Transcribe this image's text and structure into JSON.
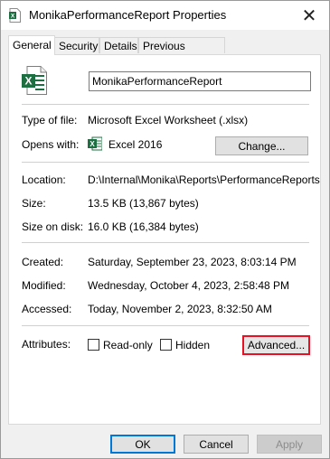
{
  "window": {
    "title": "MonikaPerformanceReport Properties",
    "close_glyph": "✕"
  },
  "tabs": [
    {
      "label": "General",
      "active": true
    },
    {
      "label": "Security"
    },
    {
      "label": "Details"
    },
    {
      "label": "Previous Versions"
    }
  ],
  "general": {
    "file_name": "MonikaPerformanceReport",
    "type_label": "Type of file:",
    "type_value": "Microsoft Excel Worksheet (.xlsx)",
    "opens_label": "Opens with:",
    "opens_value": "Excel 2016",
    "change_button": "Change...",
    "location_label": "Location:",
    "location_value": "D:\\Internal\\Monika\\Reports\\PerformanceReports",
    "size_label": "Size:",
    "size_value": "13.5 KB (13,867 bytes)",
    "size_disk_label": "Size on disk:",
    "size_disk_value": "16.0 KB (16,384 bytes)",
    "created_label": "Created:",
    "created_value": "Saturday, September 23, 2023, 8:03:14 PM",
    "modified_label": "Modified:",
    "modified_value": "Wednesday, October 4, 2023, 2:58:48 PM",
    "accessed_label": "Accessed:",
    "accessed_value": "Today, November 2, 2023, 8:32:50 AM",
    "attributes_label": "Attributes:",
    "readonly_label": "Read-only",
    "hidden_label": "Hidden",
    "advanced_button": "Advanced..."
  },
  "footer": {
    "ok": "OK",
    "cancel": "Cancel",
    "apply": "Apply"
  },
  "colors": {
    "excel_green": "#1d6f42",
    "highlight_red": "#e81123",
    "ok_border": "#0078d7"
  }
}
